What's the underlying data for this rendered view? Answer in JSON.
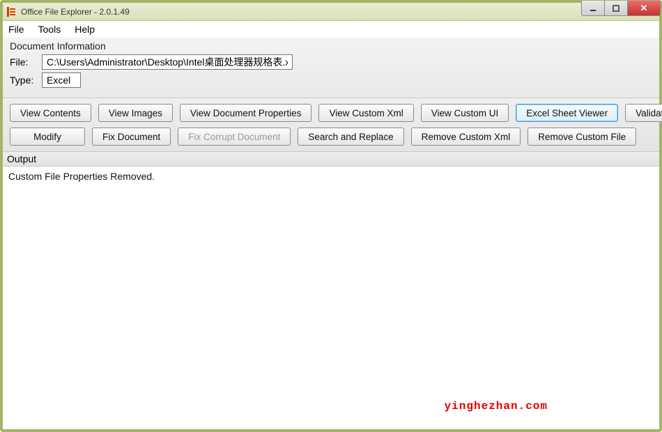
{
  "window": {
    "title": "Office File Explorer - 2.0.1.49"
  },
  "menubar": {
    "file": "File",
    "tools": "Tools",
    "help": "Help"
  },
  "docinfo": {
    "heading": "Document Information",
    "file_label": "File:",
    "file_value": "C:\\Users\\Administrator\\Desktop\\Intel桌面处理器规格表.xlsx",
    "type_label": "Type:",
    "type_value": "Excel"
  },
  "buttons": {
    "view_contents": "View Contents",
    "view_images": "View Images",
    "view_doc_props": "View Document Properties",
    "view_custom_xml": "View Custom Xml",
    "view_custom_ui": "View Custom UI",
    "excel_sheet_viewer": "Excel Sheet Viewer",
    "validate_document": "Validate Documen",
    "modify": "Modify",
    "fix_document": "Fix Document",
    "fix_corrupt_document": "Fix Corrupt Document",
    "search_and_replace": "Search and Replace",
    "remove_custom_xml": "Remove Custom Xml",
    "remove_custom_file": "Remove Custom File"
  },
  "output": {
    "label": "Output",
    "text": "Custom File Properties Removed."
  },
  "watermark": "yinghezhan.com"
}
